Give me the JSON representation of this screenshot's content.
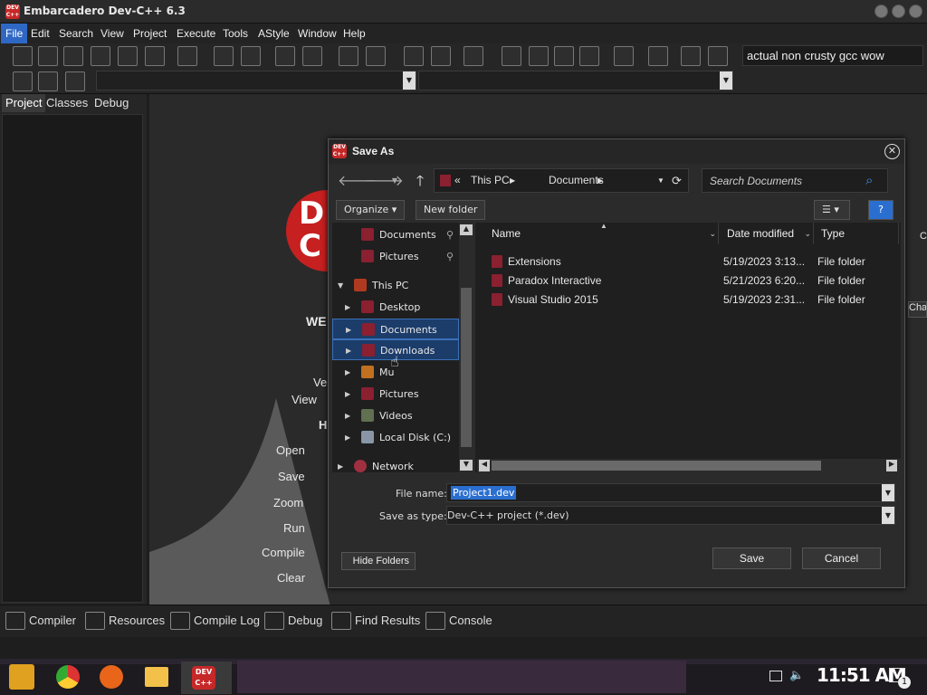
{
  "app": {
    "title": "Embarcadero Dev-C++ 6.3",
    "logo": "DEV C++"
  },
  "menu": [
    "File",
    "Edit",
    "Search",
    "View",
    "Project",
    "Execute",
    "Tools",
    "AStyle",
    "Window",
    "Help"
  ],
  "toolbar": {
    "compiler": "actual non crusty gcc wow"
  },
  "left_tabs": [
    "Project",
    "Classes",
    "Debug"
  ],
  "welcome": {
    "logo_text": "D C",
    "heading": "WE",
    "ver": "Ve",
    "view": "View",
    "h": "H",
    "items": [
      "Open",
      "Save",
      "Zoom",
      "Run",
      "Compile",
      "Clear"
    ]
  },
  "bottom_tabs": [
    "Compiler",
    "Resources",
    "Compile Log",
    "Debug",
    "Find Results",
    "Console"
  ],
  "dialog": {
    "title": "Save As",
    "address": {
      "sep": "«",
      "parts": [
        "This PC",
        "Documents"
      ]
    },
    "search_placeholder": "Search Documents",
    "organize": "Organize",
    "new_folder": "New folder",
    "help": "?",
    "nav": [
      {
        "label": "Documents",
        "pinned": true
      },
      {
        "label": "Pictures",
        "pinned": true
      },
      {
        "label": "This PC",
        "expanded": true
      },
      {
        "label": "Desktop"
      },
      {
        "label": "Documents",
        "selected": true
      },
      {
        "label": "Downloads",
        "selected": true
      },
      {
        "label": "Mu"
      },
      {
        "label": "Pictures"
      },
      {
        "label": "Videos"
      },
      {
        "label": "Local Disk (C:)"
      },
      {
        "label": "Network"
      }
    ],
    "columns": [
      "Name",
      "Date modified",
      "Type"
    ],
    "files": [
      {
        "name": "Extensions",
        "date": "5/19/2023 3:13...",
        "type": "File folder"
      },
      {
        "name": "Paradox Interactive",
        "date": "5/21/2023 6:20...",
        "type": "File folder"
      },
      {
        "name": "Visual Studio 2015",
        "date": "5/19/2023 2:31...",
        "type": "File folder"
      }
    ],
    "file_name_label": "File name:",
    "file_name": "Project1.dev",
    "save_type_label": "Save as type:",
    "save_type": "Dev-C++ project (*.dev)",
    "hide_folders": "Hide Folders",
    "save": "Save",
    "cancel": "Cancel"
  },
  "side_fragments": {
    "cha": "Cha",
    "c": "C"
  },
  "taskbar": {
    "clock": "11:51 AM",
    "notif": "1",
    "app_label": "DEV C++"
  },
  "colors": {
    "accent": "#2f68c4",
    "brand": "#c62828",
    "selection": "#1c3c6a"
  }
}
